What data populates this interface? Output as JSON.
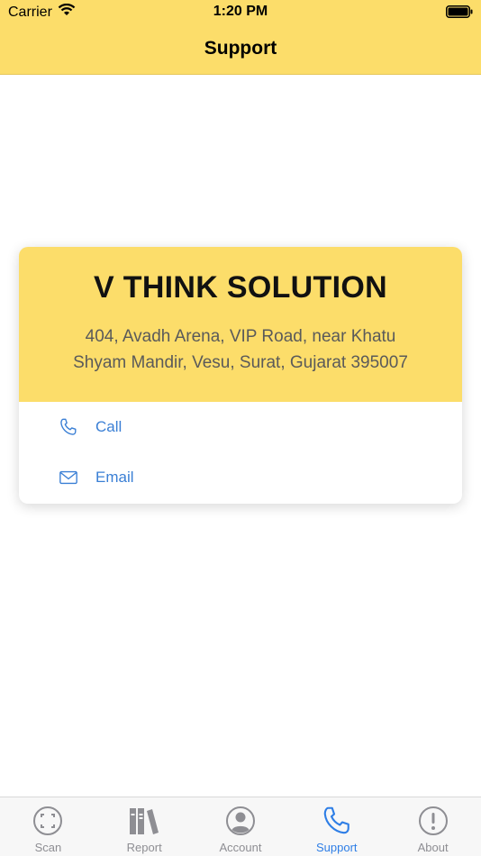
{
  "status_bar": {
    "carrier": "Carrier",
    "time": "1:20 PM"
  },
  "nav": {
    "title": "Support"
  },
  "company": {
    "name": "V THINK SOLUTION",
    "address_line1": "404, Avadh Arena, VIP Road, near Khatu",
    "address_line2": "Shyam Mandir, Vesu, Surat, Gujarat 395007"
  },
  "actions": {
    "call_label": "Call",
    "email_label": "Email"
  },
  "tabs": [
    {
      "label": "Scan",
      "icon": "scan-icon",
      "active": false
    },
    {
      "label": "Report",
      "icon": "books-icon",
      "active": false
    },
    {
      "label": "Account",
      "icon": "person-icon",
      "active": false
    },
    {
      "label": "Support",
      "icon": "phone-icon",
      "active": true
    },
    {
      "label": "About",
      "icon": "exclamation-icon",
      "active": false
    }
  ],
  "colors": {
    "header_yellow": "#fcdd6a",
    "accent_blue": "#3a7fd5",
    "tab_active": "#2e7ee6",
    "tab_inactive": "#8e8e93"
  }
}
